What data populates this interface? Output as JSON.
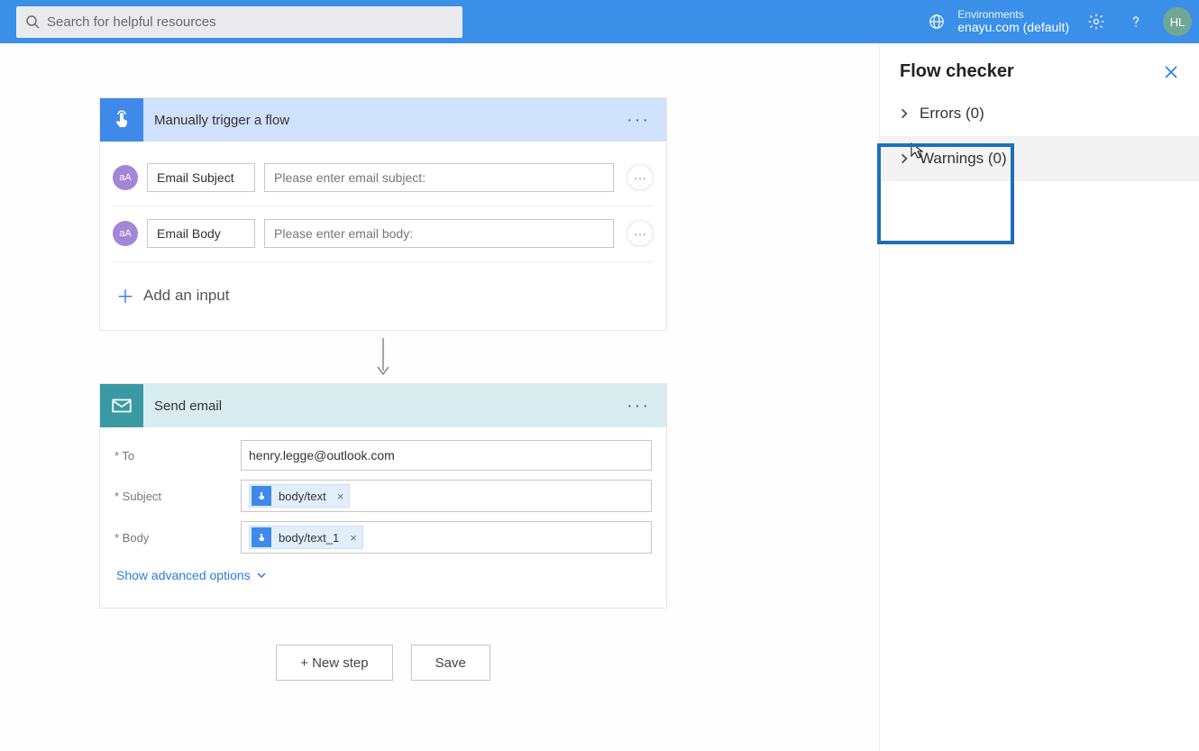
{
  "topbar": {
    "search_placeholder": "Search for helpful resources",
    "env_label": "Environments",
    "env_name": "enayu.com (default)",
    "avatar_initials": "HL"
  },
  "trigger": {
    "title": "Manually trigger a flow",
    "params": [
      {
        "chip": "aA",
        "label": "Email Subject",
        "placeholder": "Please enter email subject:"
      },
      {
        "chip": "aA",
        "label": "Email Body",
        "placeholder": "Please enter email body:"
      }
    ],
    "add_input": "Add an input"
  },
  "action": {
    "title": "Send email",
    "fields": {
      "to_label": "* To",
      "to_value": "henry.legge@outlook.com",
      "subject_label": "* Subject",
      "subject_token": "body/text",
      "body_label": "* Body",
      "body_token": "body/text_1"
    },
    "advanced": "Show advanced options"
  },
  "footer": {
    "new_step": "+ New step",
    "save": "Save"
  },
  "panel": {
    "title": "Flow checker",
    "errors": "Errors (0)",
    "warnings": "Warnings (0)"
  }
}
